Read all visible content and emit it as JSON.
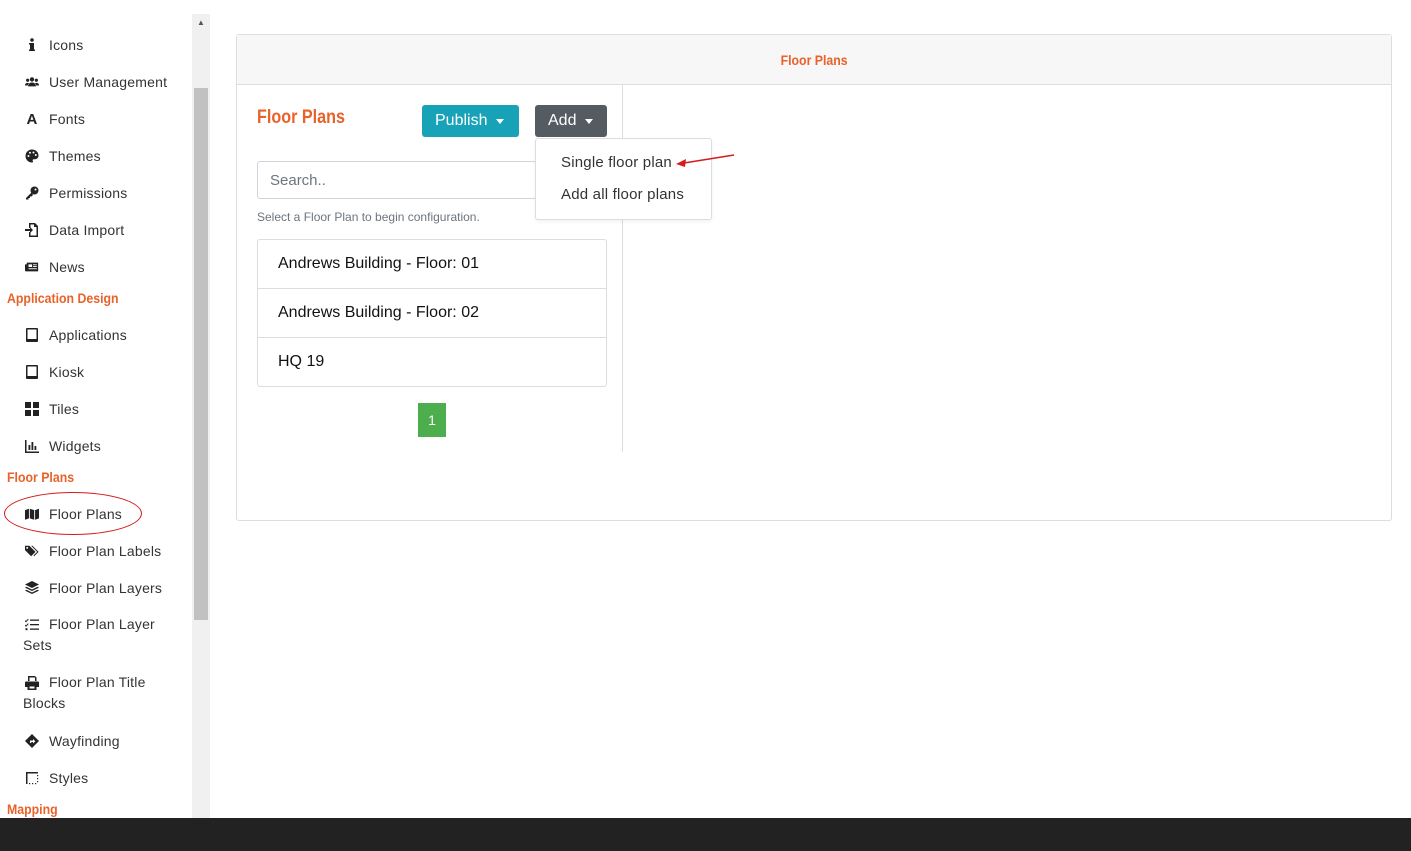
{
  "sidebar": {
    "items_top": [
      {
        "label": "Icons",
        "icon": "info-icon"
      },
      {
        "label": "User Management",
        "icon": "users-icon"
      },
      {
        "label": "Fonts",
        "icon": "font-icon"
      },
      {
        "label": "Themes",
        "icon": "palette-icon"
      },
      {
        "label": "Permissions",
        "icon": "key-icon"
      },
      {
        "label": "Data Import",
        "icon": "file-import-icon"
      },
      {
        "label": "News",
        "icon": "newspaper-icon"
      }
    ],
    "section_app_design": "Application Design",
    "items_app": [
      {
        "label": "Applications",
        "icon": "tablet-icon"
      },
      {
        "label": "Kiosk",
        "icon": "tablet-icon"
      },
      {
        "label": "Tiles",
        "icon": "th-large-icon"
      },
      {
        "label": "Widgets",
        "icon": "chart-bar-icon"
      }
    ],
    "section_floor_plans": "Floor Plans",
    "items_fp": [
      {
        "label": "Floor Plans",
        "icon": "map-icon"
      },
      {
        "label": "Floor Plan Labels",
        "icon": "tags-icon"
      },
      {
        "label": "Floor Plan Layers",
        "icon": "layer-group-icon"
      },
      {
        "label": "Floor Plan Layer Sets",
        "icon": "tasks-icon"
      },
      {
        "label": "Floor Plan Title Blocks",
        "icon": "print-icon"
      },
      {
        "label": "Wayfinding",
        "icon": "directions-icon"
      },
      {
        "label": "Styles",
        "icon": "border-style-icon"
      }
    ],
    "section_mapping": "Mapping"
  },
  "panel": {
    "header_title": "Floor Plans",
    "title": "Floor Plans",
    "publish_label": "Publish",
    "add_label": "Add",
    "search_placeholder": "Search..",
    "hint": "Select a Floor Plan to begin configuration.",
    "floor_plans": [
      "Andrews Building - Floor: 01",
      "Andrews Building - Floor: 02",
      "HQ 19"
    ],
    "page": "1"
  },
  "dropdown": {
    "items": [
      "Single floor plan",
      "Add all floor plans"
    ]
  },
  "colors": {
    "accent": "#e8622a",
    "publish": "#17a2b8",
    "add": "#545b62",
    "page": "#4cae4c",
    "annotation": "#d41c1c"
  }
}
